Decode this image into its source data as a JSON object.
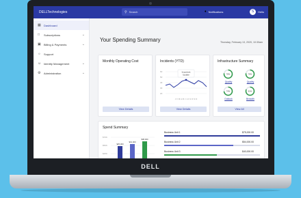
{
  "topbar": {
    "brand": "DELLTechnologies",
    "search_placeholder": "Search",
    "notifications": "Notifications",
    "user_initial": "S",
    "user_name": "Hello"
  },
  "sidebar": {
    "items": [
      {
        "label": "Dashboard",
        "icon": "dashboard-icon"
      },
      {
        "label": "Subscriptions",
        "icon": "subscriptions-icon"
      },
      {
        "label": "Billing & Payments",
        "icon": "billing-icon"
      },
      {
        "label": "Support",
        "icon": "support-icon"
      },
      {
        "label": "Identity Management",
        "icon": "identity-icon"
      },
      {
        "label": "Administration",
        "icon": "admin-icon"
      }
    ]
  },
  "main": {
    "title": "Your Spending Summary",
    "date": "Thursday, February 13, 2020, 10:30am"
  },
  "cards": {
    "operating": {
      "title": "Monthly Operating Cost",
      "button": "View Details"
    },
    "incidents": {
      "title": "Incidents (YTD)",
      "button": "View Details",
      "tooltip_line1": "Important",
      "tooltip_line2": "Update"
    },
    "infra": {
      "title": "Infrastructure Summary",
      "button": "View All",
      "rings": [
        {
          "value": "78%",
          "label": "Quality"
        },
        {
          "value": "78%",
          "label": "Quality"
        },
        {
          "value": "74%",
          "label": "Outlook"
        },
        {
          "value": "81%",
          "label": "Breadth"
        }
      ]
    },
    "spend": {
      "title": "Spend Summary",
      "bar_labels": [
        "$25,000",
        "$31,000",
        "$38,000"
      ],
      "rows": [
        {
          "label": "Business Unit 1",
          "value": "$75,000.00",
          "fill": 1.0
        },
        {
          "label": "Business Unit 2",
          "value": "$54,000.00",
          "fill": 0.72
        },
        {
          "label": "Business Unit 3",
          "value": "$40,000.00",
          "fill": 0.55
        }
      ]
    }
  },
  "laptop": {
    "logo": "DELL"
  },
  "colors": {
    "primary": "#2a39a3",
    "accent_green": "#2f9a4a",
    "background": "#5cc0ea"
  }
}
